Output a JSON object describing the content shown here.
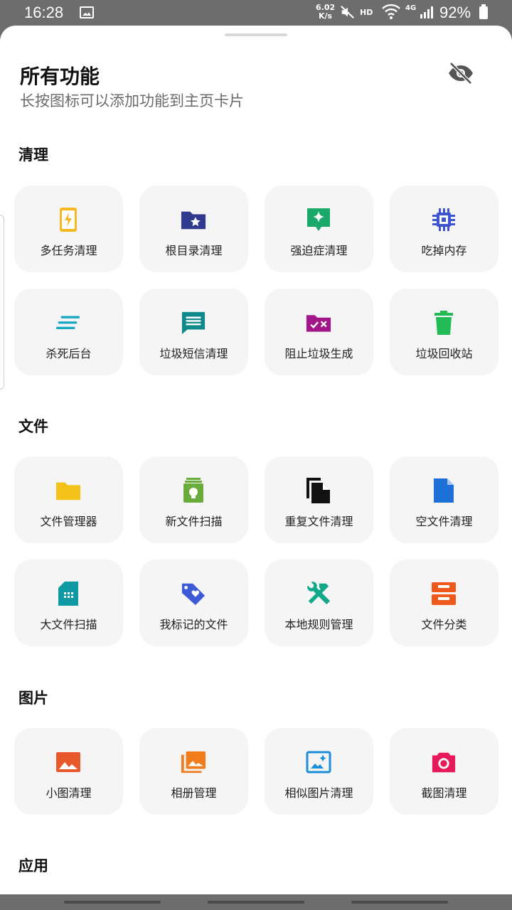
{
  "status": {
    "time": "16:28",
    "speed_value": "6.02",
    "speed_unit": "K/s",
    "hd": "HD",
    "network": "4G",
    "battery": "92%"
  },
  "header": {
    "title": "所有功能",
    "subtitle": "长按图标可以添加功能到主页卡片"
  },
  "sections": {
    "clean": {
      "title": "清理",
      "items": [
        {
          "label": "多任务清理",
          "icon": "phone-bolt-icon",
          "color": "#f6b820"
        },
        {
          "label": "根目录清理",
          "icon": "folder-star-icon",
          "color": "#2f3a8f"
        },
        {
          "label": "强迫症清理",
          "icon": "sparkle-badge-icon",
          "color": "#1aa86b"
        },
        {
          "label": "吃掉内存",
          "icon": "chip-icon",
          "color": "#3f55d0"
        },
        {
          "label": "杀死后台",
          "icon": "lines-icon",
          "color": "#19a8c4"
        },
        {
          "label": "垃圾短信清理",
          "icon": "message-icon",
          "color": "#0f8a8a"
        },
        {
          "label": "阻止垃圾生成",
          "icon": "folder-block-icon",
          "color": "#a3168a"
        },
        {
          "label": "垃圾回收站",
          "icon": "trash-icon",
          "color": "#22bb55"
        }
      ]
    },
    "files": {
      "title": "文件",
      "items": [
        {
          "label": "文件管理器",
          "icon": "folder-icon",
          "color": "#f2c21b"
        },
        {
          "label": "新文件扫描",
          "icon": "new-file-icon",
          "color": "#6aac3c"
        },
        {
          "label": "重复文件清理",
          "icon": "duplicate-file-icon",
          "color": "#111111"
        },
        {
          "label": "空文件清理",
          "icon": "empty-file-icon",
          "color": "#1f6fd8"
        },
        {
          "label": "大文件扫描",
          "icon": "sd-card-icon",
          "color": "#0f9aa3"
        },
        {
          "label": "我标记的文件",
          "icon": "tag-heart-icon",
          "color": "#3d5bd6"
        },
        {
          "label": "本地规则管理",
          "icon": "tools-icon",
          "color": "#13a889"
        },
        {
          "label": "文件分类",
          "icon": "inbox-tray-icon",
          "color": "#ef5a1c"
        }
      ]
    },
    "images": {
      "title": "图片",
      "items": [
        {
          "label": "小图清理",
          "icon": "image-icon",
          "color": "#e8582a"
        },
        {
          "label": "相册管理",
          "icon": "album-icon",
          "color": "#f07c1c"
        },
        {
          "label": "相似图片清理",
          "icon": "similar-image-icon",
          "color": "#1a8ed8"
        },
        {
          "label": "截图清理",
          "icon": "camera-icon",
          "color": "#e8195a"
        }
      ]
    },
    "apps": {
      "title": "应用"
    }
  }
}
